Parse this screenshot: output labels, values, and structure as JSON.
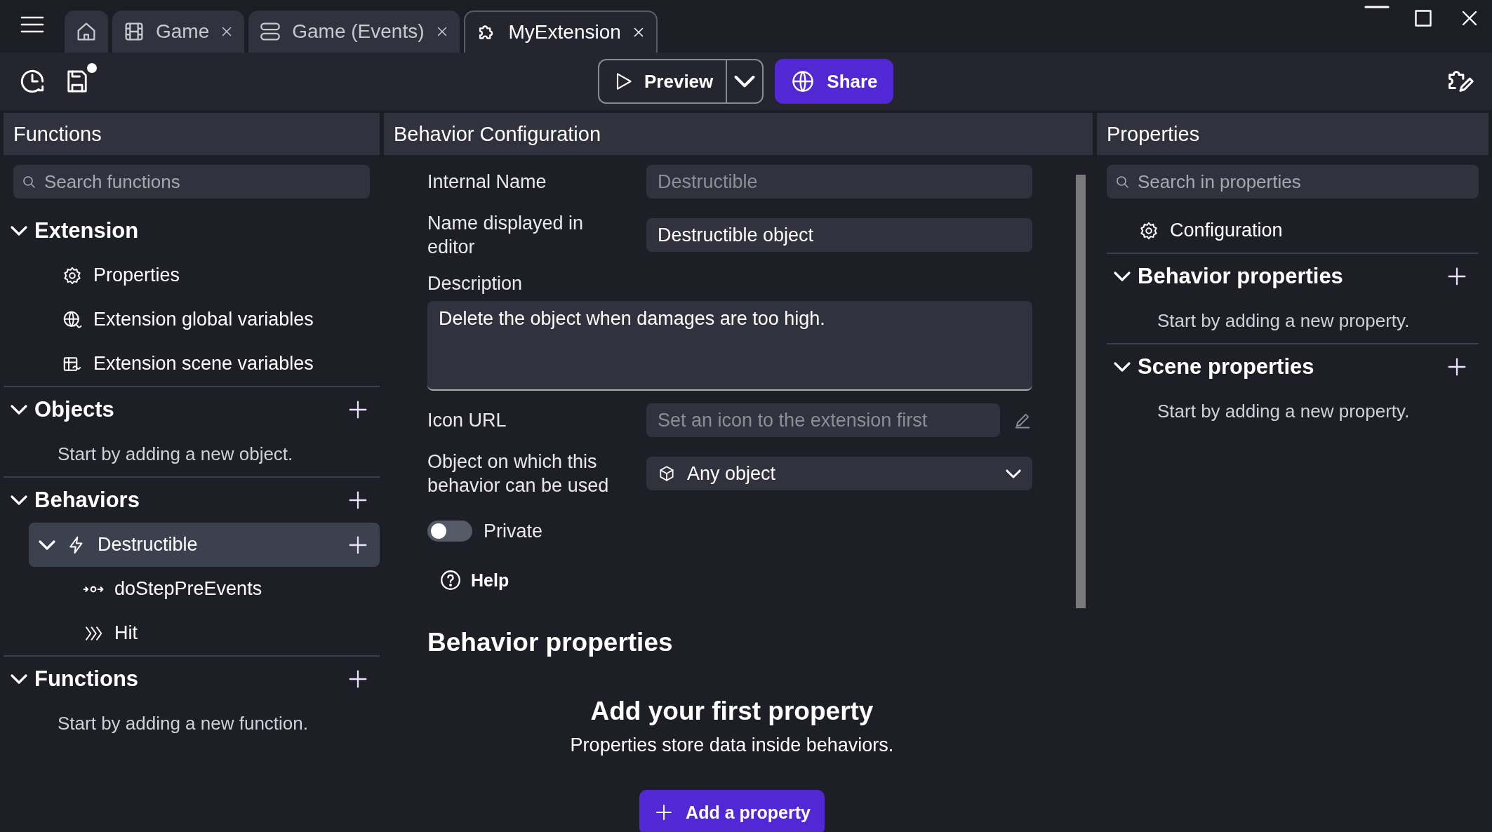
{
  "tabs": [
    {
      "kind": "home",
      "selected": false
    },
    {
      "kind": "scene",
      "label": "Game",
      "selected": false
    },
    {
      "kind": "events",
      "label": "Game (Events)",
      "selected": false
    },
    {
      "kind": "extension",
      "label": "MyExtension",
      "selected": true
    }
  ],
  "toolbar": {
    "has_unsaved_changes": true,
    "preview_button": "Preview",
    "share_button": "Share"
  },
  "functions_panel": {
    "title": "Functions",
    "search": {
      "placeholder": "Search functions"
    },
    "sections": [
      {
        "title": "Extension",
        "expanded": true,
        "addable": false,
        "items": [
          {
            "kind": "gear",
            "label": "Properties",
            "selected": false
          },
          {
            "kind": "globe-vars",
            "label": "Extension global variables",
            "selected": false
          },
          {
            "kind": "scene-vars",
            "label": "Extension scene variables",
            "selected": false
          }
        ]
      },
      {
        "title": "Objects",
        "expanded": true,
        "addable": true,
        "empty_text": "Start by adding a new object."
      },
      {
        "title": "Behaviors",
        "expanded": true,
        "addable": true,
        "items": [
          {
            "kind": "behavior",
            "label": "Destructible",
            "selected": true,
            "expanded": true,
            "children": [
              {
                "kind": "lifecycle",
                "label": "doStepPreEvents",
                "selected": false
              },
              {
                "kind": "action",
                "label": "Hit",
                "selected": false
              }
            ]
          }
        ]
      },
      {
        "title": "Functions",
        "expanded": true,
        "addable": true,
        "empty_text": "Start by adding a new function."
      }
    ]
  },
  "configuration_panel": {
    "title": "Behavior Configuration",
    "fields": [
      {
        "kind": "text",
        "label": "Internal Name",
        "value": "Destructible",
        "disabled": true
      },
      {
        "kind": "text",
        "label": "Name displayed in editor",
        "value": "Destructible object",
        "disabled": false
      },
      {
        "kind": "textarea",
        "label": "Description",
        "value": "Delete the object when damages are too high.",
        "disabled": false
      },
      {
        "kind": "text",
        "label": "Icon URL",
        "placeholder": "Set an icon to the extension first",
        "disabled": true
      },
      {
        "kind": "select",
        "label": "Object on which this behavior can be used",
        "value": "Any object",
        "disabled": false
      }
    ],
    "private_toggle": {
      "label": "Private",
      "on": false
    },
    "help_button": "Help",
    "section_title": "Behavior properties",
    "empty_state": {
      "title": "Add your first property",
      "text": "Properties store data inside behaviors.",
      "button": "Add a property"
    }
  },
  "properties_panel": {
    "title": "Properties",
    "search": {
      "placeholder": "Search in properties"
    },
    "items": [
      {
        "kind": "gear",
        "label": "Configuration",
        "selected": false
      }
    ],
    "sections": [
      {
        "title": "Behavior properties",
        "expanded": true,
        "addable": true,
        "empty_text": "Start by adding a new property."
      },
      {
        "title": "Scene properties",
        "expanded": true,
        "addable": true,
        "empty_text": "Start by adding a new property."
      }
    ]
  }
}
